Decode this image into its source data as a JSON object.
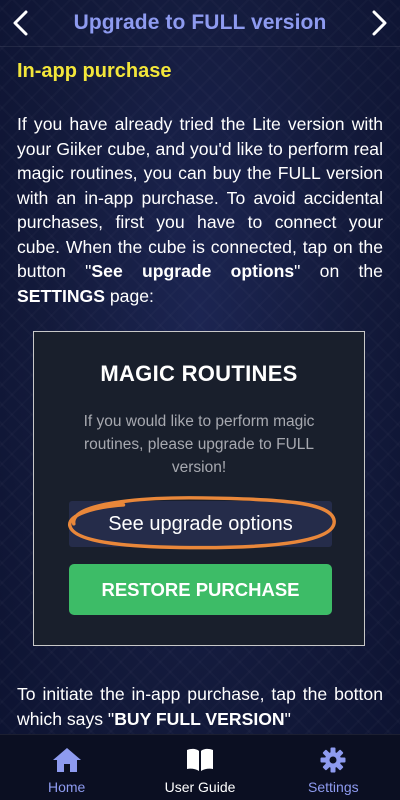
{
  "header": {
    "title": "Upgrade to FULL version",
    "prev_icon": "chevron-left-icon",
    "next_icon": "chevron-right-icon"
  },
  "content": {
    "section_title": "In-app purchase",
    "para1": {
      "text_before": "If you have already tried the Lite version with your Giiker cube, and you'd like to perform real magic routines, you can buy the FULL version with an in-app purchase. To avoid accidental purchases, first you have to connect your cube. When the cube is connected, tap on the button \"",
      "bold1": "See upgrade options",
      "text_middle": "\" on the ",
      "bold2": "SETTINGS",
      "text_after": " page:"
    },
    "screenshot": {
      "title": "MAGIC ROUTINES",
      "message": "If you would like to perform magic routines, please upgrade to FULL version!",
      "upgrade_button": "See upgrade options",
      "restore_button": "RESTORE PURCHASE",
      "highlight_color": "#e9873a"
    },
    "para2": {
      "text_before": "To initiate the in-app purchase, tap the botton which says \"",
      "bold": "BUY FULL VERSION",
      "text_after": "\""
    }
  },
  "tabs": [
    {
      "label": "Home",
      "icon": "home-icon",
      "active": false
    },
    {
      "label": "User Guide",
      "icon": "book-icon",
      "active": true
    },
    {
      "label": "Settings",
      "icon": "gear-icon",
      "active": false
    }
  ],
  "colors": {
    "accent": "#8e9bf0",
    "section_title": "#f3e63a",
    "restore_green": "#3dbc67"
  }
}
